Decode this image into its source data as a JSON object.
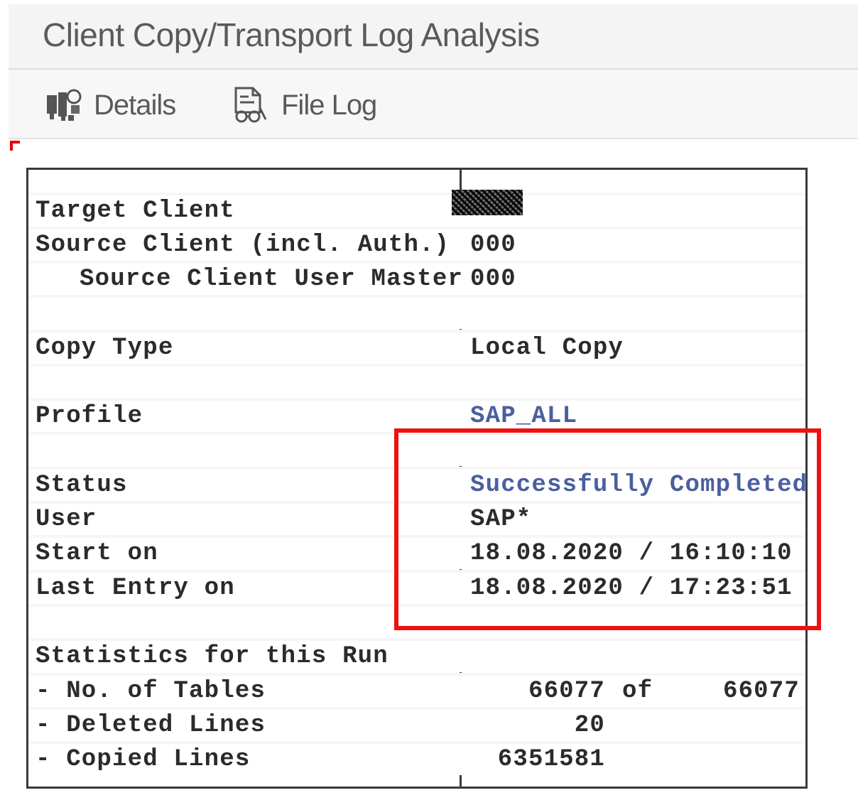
{
  "window": {
    "title": "Client Copy/Transport Log Analysis"
  },
  "toolbar": {
    "details_label": "Details",
    "details_icon": "details-icon",
    "file_log_label": "File Log",
    "file_log_icon": "file-log-icon"
  },
  "log": {
    "target_client": {
      "label": "Target Client",
      "value": ""
    },
    "source_client": {
      "label": "Source Client (incl. Auth.)",
      "value": "000"
    },
    "source_user_master": {
      "label": "Source Client User Master",
      "value": "000"
    },
    "copy_type": {
      "label": "Copy Type",
      "value": "Local Copy"
    },
    "profile": {
      "label": "Profile",
      "value": "SAP_ALL"
    },
    "status": {
      "label": "Status",
      "value": "Successfully Completed"
    },
    "user": {
      "label": "User",
      "value": "SAP*"
    },
    "start_on": {
      "label": "Start on",
      "value": "18.08.2020 / 16:10:10"
    },
    "last_entry_on": {
      "label": "Last Entry on",
      "value": "18.08.2020 / 17:23:51"
    },
    "statistics": {
      "label": "Statistics for this Run",
      "tables": {
        "label": "- No. of Tables",
        "value": "66077",
        "of_word": "of",
        "total": "66077"
      },
      "deleted_lines": {
        "label": "- Deleted Lines",
        "value": "20"
      },
      "copied_lines": {
        "label": "- Copied Lines",
        "value": "6351581"
      }
    }
  },
  "colors": {
    "highlight": "#ee1111",
    "link_value": "#4b5fa0",
    "text": "#2b2b2b"
  }
}
